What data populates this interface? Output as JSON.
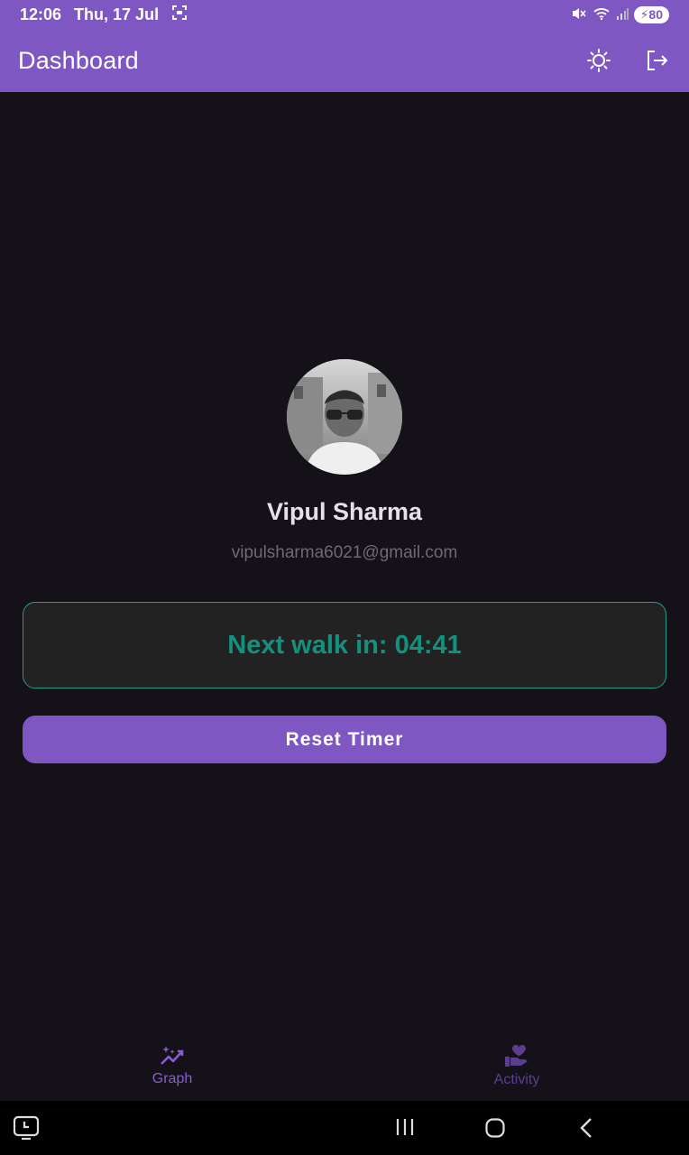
{
  "status_bar": {
    "time": "12:06",
    "date": "Thu, 17 Jul",
    "battery": "80",
    "icons": [
      "screenshot-icon",
      "mute-icon",
      "wifi-icon",
      "signal-icon",
      "battery-charging-icon"
    ]
  },
  "app_bar": {
    "title": "Dashboard",
    "actions": [
      "theme-toggle-sun-icon",
      "logout-icon"
    ]
  },
  "profile": {
    "name": "Vipul Sharma",
    "email": "vipulsharma6021@gmail.com"
  },
  "timer": {
    "label": "Next walk in: 04:41"
  },
  "reset_button": {
    "label": "Reset Timer"
  },
  "bottom_nav": {
    "items": [
      {
        "label": "Graph",
        "icon": "graph-sparkle-icon",
        "selected": true
      },
      {
        "label": "Activity",
        "icon": "heart-hand-icon",
        "selected": false
      }
    ]
  },
  "colors": {
    "primary": "#7E57C2",
    "background": "#141218",
    "accent_teal": "#14907F",
    "card_bg": "#222222"
  }
}
